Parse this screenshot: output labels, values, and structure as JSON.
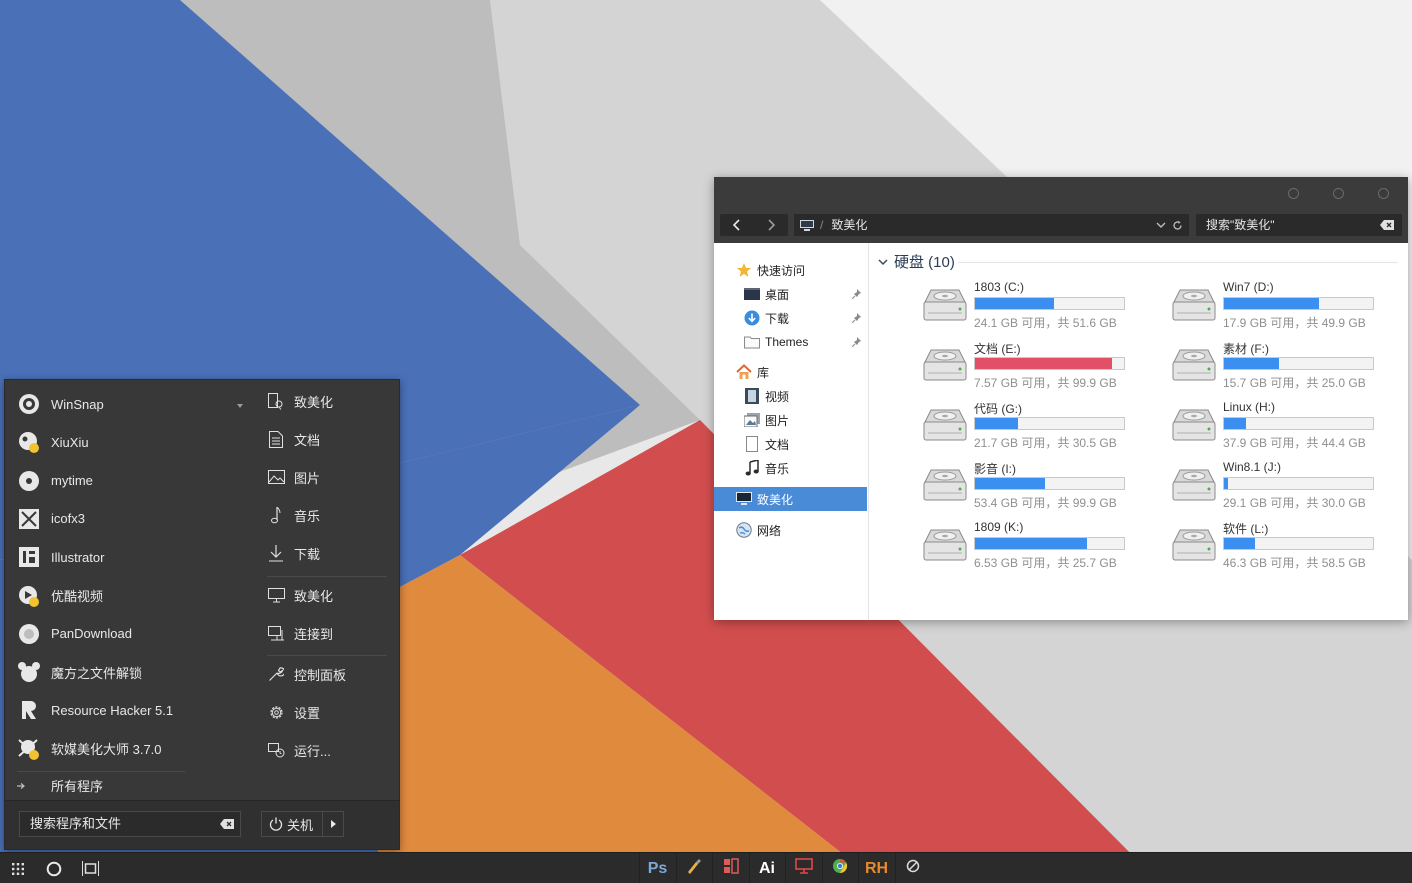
{
  "explorer": {
    "address": "致美化",
    "search_placeholder": "搜索\"致美化\"",
    "sidebar": {
      "quick_access": "快速访问",
      "desktop": "桌面",
      "downloads": "下载",
      "themes": "Themes",
      "library": "库",
      "videos": "视频",
      "pictures": "图片",
      "documents": "文档",
      "music": "音乐",
      "this_pc": "致美化",
      "network": "网络"
    },
    "group_title": "硬盘 (10)",
    "drives": [
      {
        "name": "1803 (C:)",
        "free": "24.1 GB 可用，共 51.6 GB",
        "used_fraction": 0.53,
        "warn": false
      },
      {
        "name": "Win7 (D:)",
        "free": "17.9 GB 可用，共 49.9 GB",
        "used_fraction": 0.64,
        "warn": false
      },
      {
        "name": "文档 (E:)",
        "free": "7.57 GB 可用，共 99.9 GB",
        "used_fraction": 0.92,
        "warn": true
      },
      {
        "name": "素材 (F:)",
        "free": "15.7 GB 可用，共 25.0 GB",
        "used_fraction": 0.37,
        "warn": false
      },
      {
        "name": "代码 (G:)",
        "free": "21.7 GB 可用，共 30.5 GB",
        "used_fraction": 0.29,
        "warn": false
      },
      {
        "name": "Linux (H:)",
        "free": "37.9 GB 可用，共 44.4 GB",
        "used_fraction": 0.15,
        "warn": false
      },
      {
        "name": "影音 (I:)",
        "free": "53.4 GB 可用，共 99.9 GB",
        "used_fraction": 0.47,
        "warn": false
      },
      {
        "name": "Win8.1 (J:)",
        "free": "29.1 GB 可用，共 30.0 GB",
        "used_fraction": 0.03,
        "warn": false
      },
      {
        "name": "1809 (K:)",
        "free": "6.53 GB 可用，共 25.7 GB",
        "used_fraction": 0.75,
        "warn": false
      },
      {
        "name": "软件 (L:)",
        "free": "46.3 GB 可用，共 58.5 GB",
        "used_fraction": 0.21,
        "warn": false
      }
    ]
  },
  "start_menu": {
    "apps": [
      {
        "label": "WinSnap",
        "icon": "winsnap-icon"
      },
      {
        "label": "XiuXiu",
        "icon": "xiuxiu-icon"
      },
      {
        "label": "mytime",
        "icon": "mytime-icon"
      },
      {
        "label": "icofx3",
        "icon": "icofx-icon"
      },
      {
        "label": "Illustrator",
        "icon": "illustrator-icon"
      },
      {
        "label": "优酷视频",
        "icon": "youku-icon"
      },
      {
        "label": "PanDownload",
        "icon": "pandownload-icon"
      },
      {
        "label": "魔方之文件解锁",
        "icon": "mofang-icon"
      },
      {
        "label": "Resource Hacker 5.1",
        "icon": "resource-hacker-icon"
      },
      {
        "label": "软媒美化大师 3.7.0",
        "icon": "ruanmei-icon"
      }
    ],
    "all_programs": "所有程序",
    "places": {
      "user": "致美化",
      "documents": "文档",
      "pictures": "图片",
      "music": "音乐",
      "downloads": "下载",
      "computer": "致美化",
      "connect": "连接到",
      "control_panel": "控制面板",
      "settings": "设置",
      "run": "运行..."
    },
    "search_placeholder": "搜索程序和文件",
    "power_label": "关机"
  },
  "taskbar": {
    "apps": [
      {
        "label": "Ps",
        "icon": "photoshop-icon",
        "color": "#7ca8d8"
      },
      {
        "label": "",
        "icon": "pen-tool-icon",
        "color": "#e6b24a"
      },
      {
        "label": "",
        "icon": "layout-app-icon",
        "color": "#e05a5a"
      },
      {
        "label": "Ai",
        "icon": "illustrator-icon",
        "color": "#ffffff"
      },
      {
        "label": "",
        "icon": "monitor-app-icon",
        "color": "#e04848"
      },
      {
        "label": "",
        "icon": "chrome-icon",
        "color": "#4caf50"
      },
      {
        "label": "RH",
        "icon": "resource-hacker-icon",
        "color": "#e8892a"
      },
      {
        "label": "",
        "icon": "settings-app-icon",
        "color": "#dddddd"
      }
    ]
  },
  "colors": {
    "wallpaper_blue": "#4a70b8",
    "wallpaper_orange": "#e08a3e",
    "wallpaper_red": "#d24e4e",
    "selection_blue": "#4a8bd8",
    "drive_bar": "#3b8ff0",
    "drive_bar_warn": "#e25068"
  }
}
